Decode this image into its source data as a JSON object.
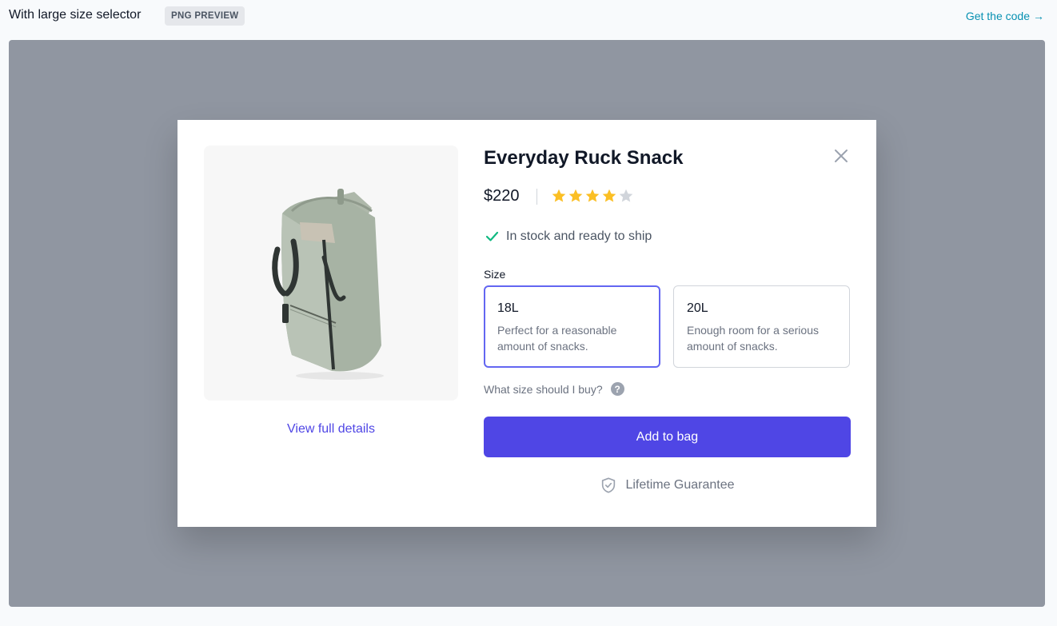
{
  "header": {
    "title": "With large size selector",
    "badge": "PNG PREVIEW",
    "get_code": "Get the code",
    "get_code_arrow": "→"
  },
  "modal": {
    "image_icon": "tote-bag-product-image",
    "view_details": "View full details",
    "close_icon": "close-icon",
    "product_title": "Everyday Ruck Snack",
    "price": "$220",
    "rating": {
      "value": 4,
      "max": 5,
      "filled_color": "#fbbf24",
      "empty_color": "#d1d5db"
    },
    "stock": "In stock and ready to ship",
    "size_label": "Size",
    "sizes": [
      {
        "name": "18L",
        "description": "Perfect for a reasonable amount of snacks.",
        "selected": true
      },
      {
        "name": "20L",
        "description": "Enough room for a serious amount of snacks.",
        "selected": false
      }
    ],
    "help_text": "What size should I buy?",
    "help_icon_glyph": "?",
    "add_to_bag": "Add to bag",
    "guarantee": "Lifetime Guarantee"
  },
  "colors": {
    "accent": "#4f46e5",
    "link_cyan": "#0891b2",
    "stock_check": "#10b981",
    "overlay": "#9096a1"
  }
}
